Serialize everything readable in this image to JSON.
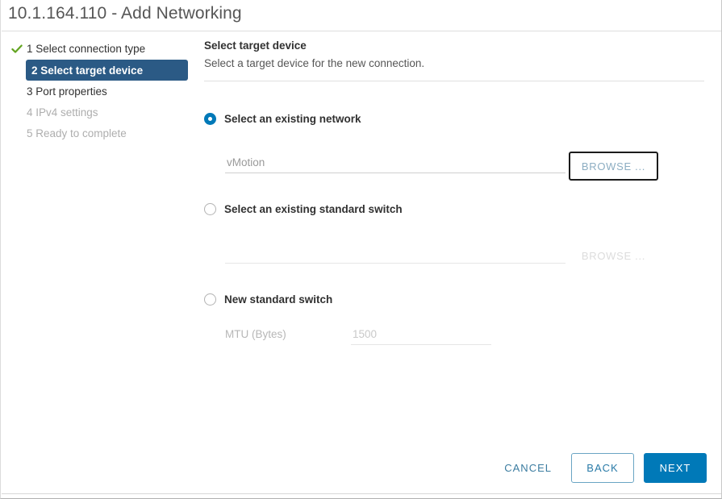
{
  "window": {
    "title": "10.1.164.110 - Add Networking"
  },
  "sidebar": {
    "steps": [
      {
        "label": "1 Select connection type",
        "state": "complete",
        "icon": "check-icon"
      },
      {
        "label": "2 Select target device",
        "state": "active"
      },
      {
        "label": "3 Port properties",
        "state": "upcoming"
      },
      {
        "label": "4 IPv4 settings",
        "state": "disabled"
      },
      {
        "label": "5 Ready to complete",
        "state": "disabled"
      }
    ]
  },
  "main": {
    "heading": "Select target device",
    "description": "Select a target device for the new connection.",
    "options": [
      {
        "label": "Select an existing network",
        "selected": true,
        "input_value": "vMotion",
        "input_placeholder": "vMotion",
        "browse_label": "BROWSE ...",
        "browse_state": "focused"
      },
      {
        "label": "Select an existing standard switch",
        "selected": false,
        "input_value": "",
        "input_placeholder": "",
        "browse_label": "BROWSE ...",
        "browse_state": "disabled"
      },
      {
        "label": "New standard switch",
        "selected": false,
        "mtu_label": "MTU (Bytes)",
        "mtu_value": "1500",
        "mtu_placeholder": "1500"
      }
    ]
  },
  "footer": {
    "cancel_label": "CANCEL",
    "back_label": "BACK",
    "next_label": "NEXT"
  },
  "colors": {
    "accent_blue": "#0079b8",
    "active_step_bg": "#2b5a85",
    "check_green": "#62a420",
    "text_primary": "#313131",
    "text_muted": "#aeaeae"
  }
}
